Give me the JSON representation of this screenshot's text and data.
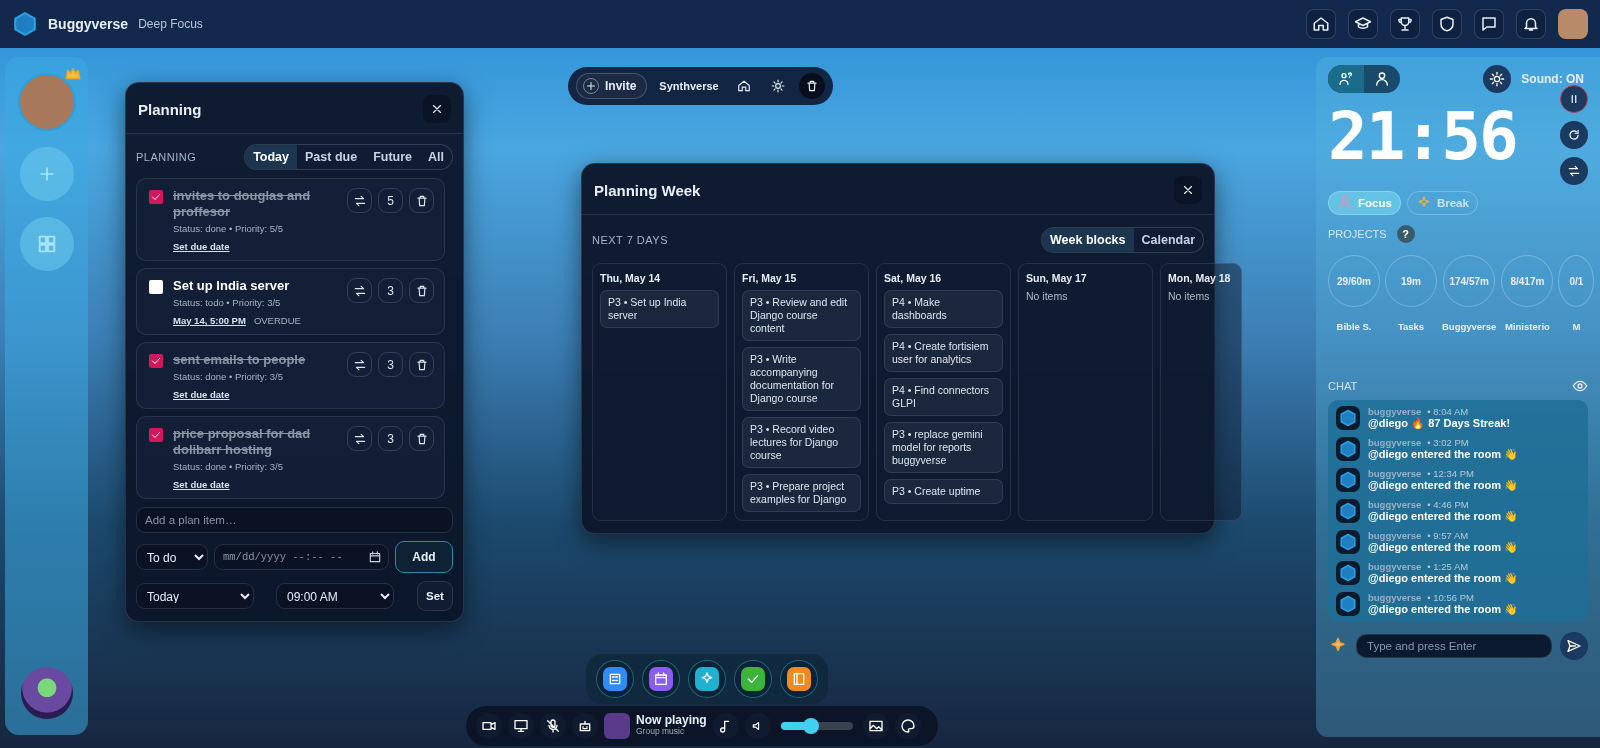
{
  "topbar": {
    "brand": "Buggyverse",
    "subtitle": "Deep Focus"
  },
  "planning": {
    "title": "Planning",
    "section": "PLANNING",
    "tabs": [
      {
        "label": "Today",
        "selected": true
      },
      {
        "label": "Past due",
        "selected": false
      },
      {
        "label": "Future",
        "selected": false
      },
      {
        "label": "All",
        "selected": false
      }
    ],
    "items": [
      {
        "title": "invites to douglas and proffesor",
        "checked": true,
        "meta": "Status: done • Priority: 5/5",
        "priority": "5",
        "due": "Set due date"
      },
      {
        "title": "Set up India server",
        "checked": false,
        "meta": "Status: todo • Priority: 3/5",
        "priority": "3",
        "due": "May 14, 5:00 PM",
        "overdue": "OVERDUE"
      },
      {
        "title": "sent emails to people",
        "checked": true,
        "meta": "Status: done • Priority: 3/5",
        "priority": "3",
        "due": "Set due date"
      },
      {
        "title": "price proposal for dad dolibarr hosting",
        "checked": true,
        "meta": "Status: done • Priority: 3/5",
        "priority": "3",
        "due": "Set due date"
      }
    ],
    "add_placeholder": "Add a plan item…",
    "status_select": "To do",
    "date_placeholder": "mm/dd/yyyy --:-- --",
    "add_button": "Add",
    "day_select": "Today",
    "time_select": "09:00 AM",
    "set_button": "Set"
  },
  "invite_bar": {
    "invite": "Invite",
    "room": "Synthverse"
  },
  "week": {
    "title": "Planning Week",
    "section": "NEXT 7 DAYS",
    "tabs": [
      {
        "label": "Week blocks",
        "selected": true
      },
      {
        "label": "Calendar",
        "selected": false
      }
    ],
    "days": [
      {
        "label": "Thu, May 14",
        "items": [
          "P3 • Set up India server"
        ]
      },
      {
        "label": "Fri, May 15",
        "items": [
          "P3 • Review and edit Django course content",
          "P3 • Write accompanying documentation for Django course",
          "P3 • Record video lectures for Django course",
          "P3 • Prepare project examples for Django"
        ]
      },
      {
        "label": "Sat, May 16",
        "items": [
          "P4 • Make dashboards",
          "P4 • Create fortisiem user for analytics",
          "P4 • Find connectors GLPI",
          "P3 • replace gemini model for reports buggyverse",
          "P3 • Create uptime"
        ]
      },
      {
        "label": "Sun, May 17",
        "empty": "No items"
      },
      {
        "label": "Mon, May 18",
        "empty": "No items"
      }
    ]
  },
  "timer": {
    "view_tabs": [
      {
        "kind": "group",
        "selected": true
      },
      {
        "kind": "solo",
        "selected": false
      }
    ],
    "sound": "Sound: ON",
    "clock": "21:56",
    "modes": [
      {
        "label": "Focus",
        "kind": "focus",
        "selected": true
      },
      {
        "label": "Break",
        "kind": "break",
        "selected": false
      }
    ],
    "projects_label": "PROJECTS",
    "help": "?",
    "projects": [
      {
        "value": "29/60m",
        "name": "Bible S."
      },
      {
        "value": "19m",
        "name": "Tasks"
      },
      {
        "value": "174/57m",
        "name": "Buggyverse"
      },
      {
        "value": "8/417m",
        "name": "Ministerio"
      },
      {
        "value": "0/1",
        "name": "M"
      }
    ]
  },
  "chat": {
    "label": "CHAT",
    "messages": [
      {
        "user": "buggyverse",
        "time": "• 8:04 AM",
        "text": "@diego 🔥 87 Days Streak!"
      },
      {
        "user": "buggyverse",
        "time": "• 3:02 PM",
        "text": "@diego entered the room 👋"
      },
      {
        "user": "buggyverse",
        "time": "• 12:34 PM",
        "text": "@diego entered the room 👋"
      },
      {
        "user": "buggyverse",
        "time": "• 4:46 PM",
        "text": "@diego entered the room 👋"
      },
      {
        "user": "buggyverse",
        "time": "• 9:57 AM",
        "text": "@diego entered the room 👋"
      },
      {
        "user": "buggyverse",
        "time": "• 1:25 AM",
        "text": "@diego entered the room 👋"
      },
      {
        "user": "buggyverse",
        "time": "• 10:56 PM",
        "text": "@diego entered the room 👋"
      }
    ],
    "placeholder": "Type and press Enter"
  },
  "player": {
    "title": "Now playing",
    "subtitle": "Group music",
    "level": 0.42
  }
}
